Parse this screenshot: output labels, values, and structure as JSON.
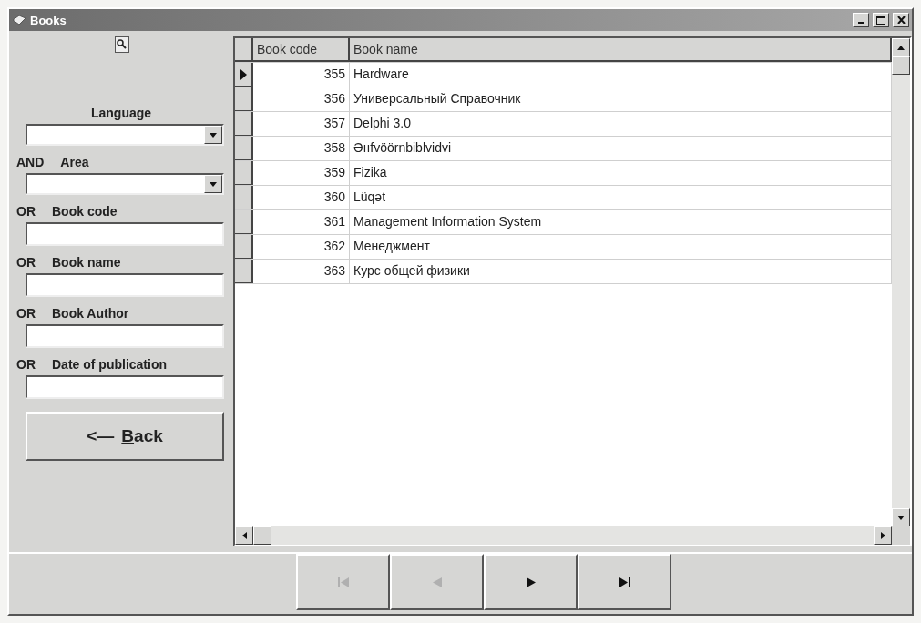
{
  "window": {
    "title": "Books"
  },
  "filters": [
    {
      "kind": "combo",
      "label": "Language"
    },
    {
      "kind": "combo",
      "connector": "AND",
      "label": "Area"
    },
    {
      "kind": "text",
      "connector": "OR",
      "label": "Book code"
    },
    {
      "kind": "text",
      "connector": "OR",
      "label": "Book name"
    },
    {
      "kind": "text",
      "connector": "OR",
      "label": "Book Author"
    },
    {
      "kind": "text",
      "connector": "OR",
      "label": "Date of publication"
    }
  ],
  "back_button": {
    "arrow": "<—",
    "label": "Back"
  },
  "table": {
    "columns": [
      "Book code",
      "Book name"
    ],
    "rows": [
      {
        "code": "355",
        "name": "Hardware",
        "selected": true
      },
      {
        "code": "356",
        "name": "Универсальный Справочник",
        "selected": false
      },
      {
        "code": "357",
        "name": "Delphi 3.0",
        "selected": false
      },
      {
        "code": "358",
        "name": "Əııfvöörnbiblvidvi",
        "selected": false
      },
      {
        "code": "359",
        "name": "Fizika",
        "selected": false
      },
      {
        "code": "360",
        "name": "Lüqət",
        "selected": false
      },
      {
        "code": "361",
        "name": "Management Information System",
        "selected": false
      },
      {
        "code": "362",
        "name": "Менеджмент",
        "selected": false
      },
      {
        "code": "363",
        "name": "Курс общей физики",
        "selected": false
      }
    ]
  },
  "navigator": [
    {
      "kind": "first",
      "disabled": true
    },
    {
      "kind": "prior",
      "disabled": true
    },
    {
      "kind": "next",
      "disabled": false
    },
    {
      "kind": "last",
      "disabled": false
    }
  ]
}
